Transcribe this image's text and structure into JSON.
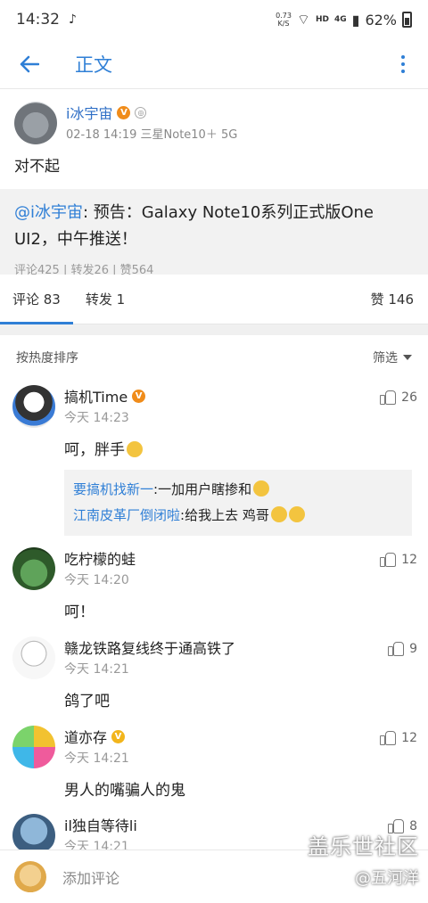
{
  "status_bar": {
    "time": "14:32",
    "speed": "0.73",
    "speed_unit": "K/S",
    "hd": "HD",
    "net": "4G",
    "battery": "62%"
  },
  "app_bar": {
    "title": "正文"
  },
  "post": {
    "username": "i冰宇宙",
    "date": "02-18 14:19",
    "device": "三星Note10＋ 5G",
    "text": "对不起",
    "repost": {
      "mention": "@i冰宇宙",
      "text": ": 预告：Galaxy Note10系列正式版One UI2，中午推送！",
      "stats": "评论425 | 转发26 | 赞564"
    }
  },
  "tabs": {
    "comments": "评论 83",
    "reposts": "转发 1",
    "likes": "赞 146"
  },
  "sort": {
    "label": "按热度排序",
    "filter": "筛选"
  },
  "comments": [
    {
      "name": "搞机Time",
      "time": "今天 14:23",
      "likes": "26",
      "text": "呵，胖手",
      "replies": [
        {
          "who": "要搞机找新一",
          "text": ":一加用户瞎掺和"
        },
        {
          "who": "江南皮革厂倒闭啦",
          "text": ":给我上去 鸡哥"
        }
      ]
    },
    {
      "name": "吃柠檬的蛙",
      "time": "今天 14:20",
      "likes": "12",
      "text": "呵！"
    },
    {
      "name": "赣龙铁路复线终于通高铁了",
      "time": "今天 14:21",
      "likes": "9",
      "text": "鸽了吧"
    },
    {
      "name": "道亦存",
      "time": "今天 14:21",
      "likes": "12",
      "text": "男人的嘴骗人的鬼"
    },
    {
      "name": "il独自等待li",
      "time": "今天 14:21",
      "likes": "8"
    }
  ],
  "bottom": {
    "placeholder": "添加评论"
  },
  "watermark": {
    "line1": "盖乐世社区",
    "line2": "@五河洋"
  },
  "colors": {
    "accent": "#2f7fd6",
    "badge": "#f08c1a"
  }
}
